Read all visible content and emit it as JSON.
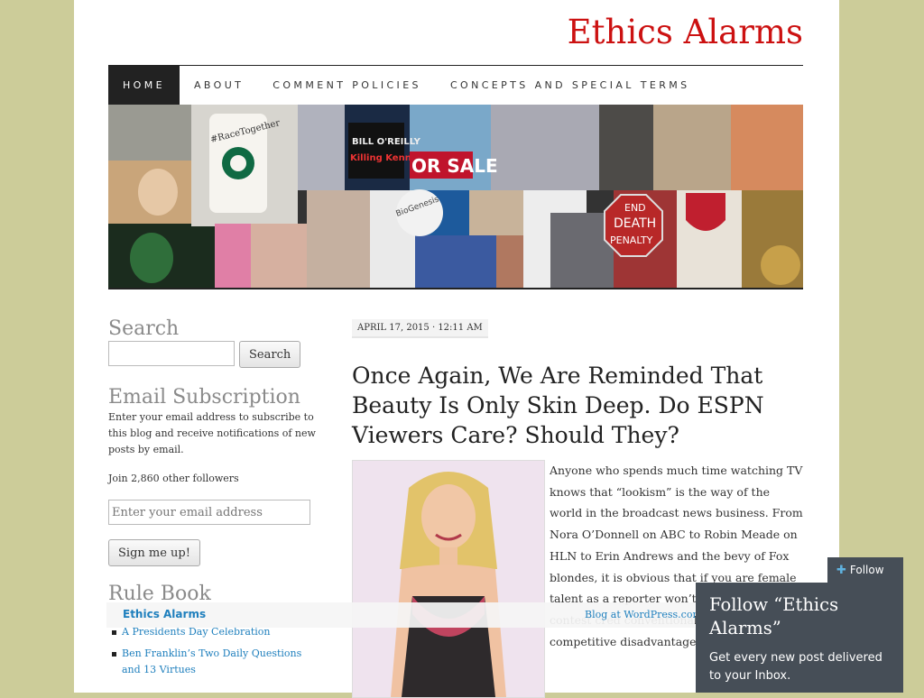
{
  "site": {
    "title": "Ethics Alarms"
  },
  "nav": {
    "items": [
      {
        "label": "HOME",
        "active": true
      },
      {
        "label": "ABOUT"
      },
      {
        "label": "COMMENT POLICIES"
      },
      {
        "label": "CONCEPTS AND SPECIAL TERMS"
      }
    ]
  },
  "header": {
    "collage_texts": {
      "cup": "#RaceTogether",
      "book_line1": "BILL O'REILLY",
      "book_line2": "Killing Kennedy",
      "sale": "OR SALE",
      "biogenesis": "BioGenesis",
      "sign_line1": "END",
      "sign_line2": "DEATH",
      "sign_line3": "PENALTY"
    }
  },
  "sidebar": {
    "search_title": "Search",
    "search_button": "Search",
    "email_title": "Email Subscription",
    "email_description": "Enter your email address to subscribe to this blog and receive notifications of new posts by email.",
    "followers_text": "Join 2,860 other followers",
    "email_placeholder": "Enter your email address",
    "signup_button": "Sign me up!",
    "rulebook_title": "Rule Book",
    "rulebook_items": [
      "A Presidents Day Celebration",
      "Ben Franklin’s Two Daily Questions and 13 Virtues"
    ]
  },
  "post": {
    "date": "APRIL 17, 2015 · 12:11 AM",
    "title": "Once Again, We Are Reminded That Beauty Is Only Skin Deep. Do ESPN Viewers Care? Should They?",
    "excerpt": "Anyone who spends much time watching TV knows that “lookism” is the way of the world in the broadcast news business. From Nora O’Donnell on ABC to Robin Meade on HLN to Erin Andrews and the bevy of Fox blondes, it is obvious that if you are female talent as a reporter won’t some beauty contest cred conventionally pretty women competitive disadvantage"
  },
  "bottom_bar": {
    "blog_name": "Ethics Alarms",
    "wp_credit": "Blog at WordPress.com."
  },
  "follow": {
    "tab_label": "Follow",
    "title": "Follow “Ethics Alarms”",
    "text": "Get every new post delivered to your Inbox."
  },
  "colors": {
    "background": "#cccc99",
    "title_red": "#cc1111",
    "link_blue": "#1e7fbd",
    "follow_panel": "#464e57"
  }
}
